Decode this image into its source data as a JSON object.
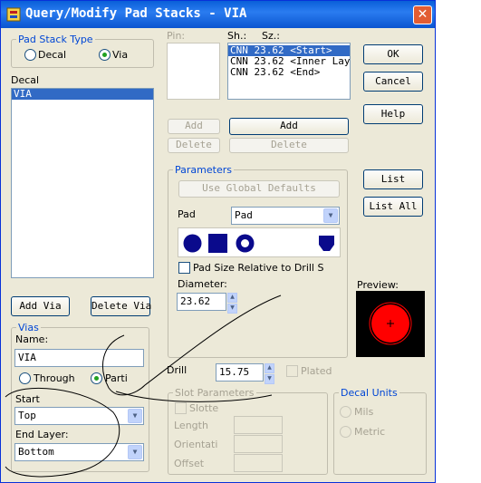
{
  "title": "Query/Modify Pad Stacks - VIA",
  "pad_stack_type": {
    "legend": "Pad Stack Type",
    "decal_label": "Decal",
    "via_label": "Via",
    "selected": "Via"
  },
  "decal": {
    "label": "Decal",
    "items": [
      "VIA"
    ],
    "selected_index": 0
  },
  "left_buttons": {
    "add_via": "Add Via",
    "delete_via": "Delete Via"
  },
  "vias": {
    "legend": "Vias",
    "name_label": "Name:",
    "name_value": "VIA",
    "through_label": "Through",
    "partial_label": "Parti",
    "selected": "Partial",
    "start_label": "Start",
    "start_value": "Top",
    "end_label": "End Layer:",
    "end_value": "Bottom"
  },
  "pin": {
    "label": "Pin:"
  },
  "sh_sz": {
    "sh_label": "Sh.:",
    "sz_label": "Sz.:",
    "items": [
      "CNN 23.62 <Start>",
      "CNN 23.62 <Inner Layer",
      "CNN 23.62 <End>"
    ],
    "selected_index": 0
  },
  "middle_buttons": {
    "add_small": "Add",
    "delete_small": "Delete",
    "add_big": "Add",
    "delete_big": "Delete"
  },
  "parameters": {
    "legend": "Parameters",
    "use_global_defaults": "Use Global Defaults",
    "pad_label": "Pad",
    "pad_value": "Pad",
    "shapes": [
      "round",
      "square",
      "annular",
      "odd"
    ],
    "relative_checkbox_label": "Pad Size Relative to Drill S",
    "diameter_label": "Diameter:",
    "diameter_value": "23.62"
  },
  "drill": {
    "label": "Drill",
    "value": "15.75",
    "plated_label": "Plated"
  },
  "slot": {
    "legend": "Slot Parameters",
    "slotted_label": "Slotte",
    "length_label": "Length",
    "orientation_label": "Orientati",
    "offset_label": "Offset"
  },
  "decal_units": {
    "legend": "Decal Units",
    "mils_label": "Mils",
    "metric_label": "Metric"
  },
  "right_buttons": {
    "ok": "OK",
    "cancel": "Cancel",
    "help": "Help",
    "list": "List",
    "list_all": "List All"
  },
  "preview": {
    "label": "Preview:"
  },
  "colors": {
    "title_bar": "#0a5fd8",
    "selection": "#316ac5",
    "shape_fill": "#0a0a8c",
    "preview_pad": "#ff0000"
  }
}
